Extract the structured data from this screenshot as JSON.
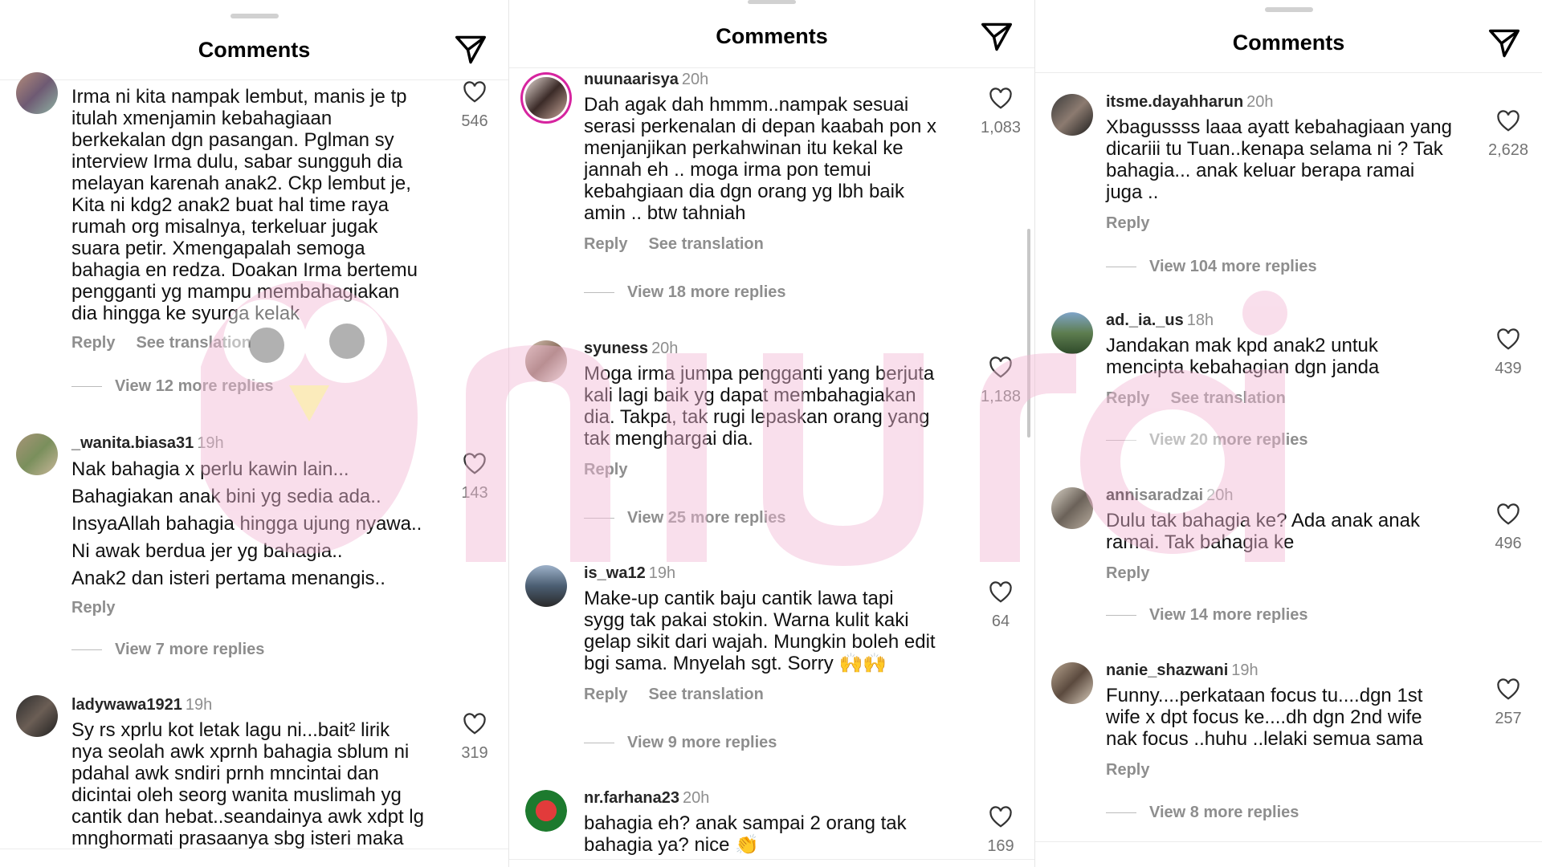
{
  "header_title": "Comments",
  "panels": [
    {
      "comments": [
        {
          "username": "",
          "time": "",
          "text": "Irma ni kita nampak lembut, manis je tp\nitulah xmenjamin kebahagiaan\nberkekalan dgn pasangan. Pglman sy\ninterview Irma dulu, sabar sungguh dia\nmelayan karenah anak2. Ckp lembut je,\nKita ni kdg2 anak2 buat hal time raya\nrumah org misalnya, terkeluar jugak\nsuara petir. Xmengapalah semoga\nbahagia en redza. Doakan Irma bertemu\npengganti yg mampu membahagiakan\ndia hingga ke syurga kelak",
          "reply": "Reply",
          "translation": "See translation",
          "likes": "546",
          "view_replies": "View 12 more replies"
        },
        {
          "username": "_wanita.biasa31",
          "time": "19h",
          "text": "Nak bahagia x perlu kawin lain...\nBahagiakan anak bini yg sedia ada..\nInsyaAllah bahagia hingga ujung nyawa..\nNi awak berdua jer yg bahagia..\nAnak2 dan isteri pertama menangis..",
          "reply": "Reply",
          "likes": "143",
          "view_replies": "View 7 more replies"
        },
        {
          "username": "ladywawa1921",
          "time": "19h",
          "text": "Sy rs xprlu kot letak lagu ni...bait² lirik\nnya seolah awk xprnh bahagia sblum ni\npdahal awk sndiri prnh mncintai dan\ndicintai oleh seorg wanita muslimah yg\ncantik dan hebat..seandainya awk xdpt lg\nmnghormati prasaanya sbg isteri maka",
          "likes": "319"
        }
      ]
    },
    {
      "comments": [
        {
          "username": "nuunaarisya",
          "time": "20h",
          "text": "Dah agak dah hmmm..nampak sesuai\nserasi perkenalan di depan kaabah pon x\nmenjanjikan perkahwinan itu kekal ke\njannah eh .. moga irma pon temui\nkebahgiaan dia dgn orang yg lbh baik\namin .. btw tahniah",
          "reply": "Reply",
          "translation": "See translation",
          "likes": "1,083",
          "view_replies": "View 18 more replies"
        },
        {
          "username": "syuness",
          "time": "20h",
          "text": "Moga irma jumpa pengganti yang berjuta\nkali lagi baik yg dapat membahagiakan\ndia. Takpa, tak rugi lepaskan orang yang\ntak menghargai dia.",
          "reply": "Reply",
          "likes": "1,188",
          "view_replies": "View 25 more replies"
        },
        {
          "username": "is_wa12",
          "time": "19h",
          "text": "Make-up cantik baju cantik lawa tapi\nsygg tak pakai stokin. Warna kulit kaki\ngelap sikit dari wajah. Mungkin boleh edit\nbgi sama. Mnyelah sgt. Sorry 🙌🙌",
          "reply": "Reply",
          "translation": "See translation",
          "likes": "64",
          "view_replies": "View 9 more replies"
        },
        {
          "username": "nr.farhana23",
          "time": "20h",
          "text": "bahagia eh? anak sampai 2 orang tak\nbahagia ya? nice 👏",
          "likes": "169"
        }
      ]
    },
    {
      "comments": [
        {
          "username": "itsme.dayahharun",
          "time": "20h",
          "text": "Xbagussss laaa ayatt kebahagiaan yang\ndicariii tu Tuan..kenapa selama ni ? Tak\nbahagia... anak keluar berapa ramai\njuga ..",
          "reply": "Reply",
          "likes": "2,628",
          "view_replies": "View 104 more replies"
        },
        {
          "username": "ad._ia._us",
          "time": "18h",
          "text": "Jandakan mak kpd anak2 untuk\nmencipta kebahagian dgn janda",
          "reply": "Reply",
          "translation": "See translation",
          "likes": "439",
          "view_replies": "View 20 more replies"
        },
        {
          "username": "annisaradzai",
          "time": "20h",
          "text": "Dulu tak bahagia ke? Ada anak anak\nramai. Tak bahagia ke",
          "reply": "Reply",
          "likes": "496",
          "view_replies": "View 14 more replies"
        },
        {
          "username": "nanie_shazwani",
          "time": "19h",
          "text": "Funny....perkataan focus tu....dgn 1st\nwife x dpt focus ke....dh dgn 2nd wife\nnak focus ..huhu ..lelaki semua sama",
          "reply": "Reply",
          "likes": "257",
          "view_replies": "View 8 more replies"
        }
      ]
    }
  ],
  "colors": {
    "muted": "#8e8e8e",
    "story_ring": "#d6249f",
    "watermark": "#f5c6dc"
  },
  "icons": {
    "send": "send-icon",
    "like": "heart-icon"
  }
}
